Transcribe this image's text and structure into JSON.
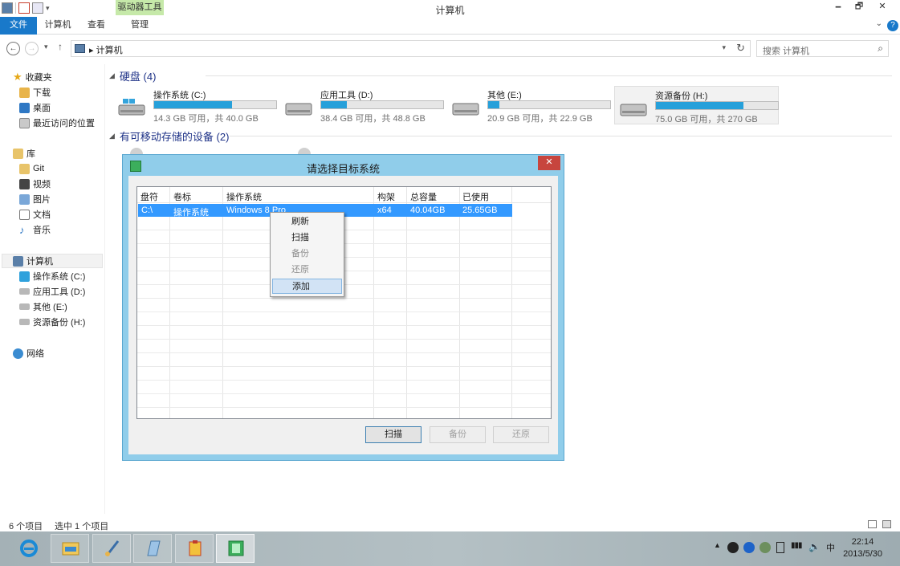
{
  "window": {
    "title": "计算机",
    "contextual_tab_group": "驱动器工具",
    "minimize_glyph": "🗕",
    "restore_glyph": "🗗",
    "close_glyph": "✕"
  },
  "ribbon": {
    "tabs": [
      "文件",
      "计算机",
      "查看",
      "管理"
    ],
    "help_glyph": "?",
    "collapse_glyph": "⌄"
  },
  "address": {
    "breadcrumb": "计算机",
    "search_placeholder": "搜索 计算机"
  },
  "nav": {
    "favorites": {
      "label": "收藏夹",
      "items": [
        "下载",
        "桌面",
        "最近访问的位置"
      ]
    },
    "libraries": {
      "label": "库",
      "items": [
        "Git",
        "视频",
        "图片",
        "文档",
        "音乐"
      ]
    },
    "computer": {
      "label": "计算机",
      "items": [
        "操作系统 (C:)",
        "应用工具 (D:)",
        "其他 (E:)",
        "资源备份 (H:)"
      ]
    },
    "network": {
      "label": "网络"
    }
  },
  "content": {
    "hdd_group": "硬盘 (4)",
    "removable_group": "有可移动存储的设备 (2)",
    "drives": [
      {
        "name": "操作系统 (C:)",
        "info": "14.3 GB 可用，共 40.0 GB",
        "used_fraction": 0.64
      },
      {
        "name": "应用工具 (D:)",
        "info": "38.4 GB 可用，共 48.8 GB",
        "used_fraction": 0.21
      },
      {
        "name": "其他 (E:)",
        "info": "20.9 GB 可用，共 22.9 GB",
        "used_fraction": 0.09
      },
      {
        "name": "资源备份 (H:)",
        "info": "75.0 GB 可用，共 270 GB",
        "used_fraction": 0.72
      }
    ]
  },
  "status": {
    "count": "6 个项目",
    "selected": "选中 1 个项目"
  },
  "dialog": {
    "title": "请选择目标系统",
    "close_glyph": "✕",
    "columns": [
      "盘符",
      "卷标",
      "操作系统",
      "构架",
      "总容量",
      "已使用"
    ],
    "row": [
      "C:\\",
      "操作系统",
      "Windows 8 Pro",
      "x64",
      "40.04GB",
      "25.65GB"
    ],
    "buttons": {
      "scan": "扫描",
      "backup": "备份",
      "restore": "还原"
    }
  },
  "context_menu": {
    "items": [
      "刷新",
      "扫描",
      "备份",
      "还原",
      "添加"
    ]
  },
  "taskbar": {
    "ime": "中",
    "time": "22:14",
    "date": "2013/5/30"
  },
  "colors": {
    "accent": "#1979ca",
    "drive_bar": "#26a0da",
    "selection": "#3399ff",
    "dialog_frame": "#90cdea",
    "context_tab": "#c6e9a9"
  }
}
